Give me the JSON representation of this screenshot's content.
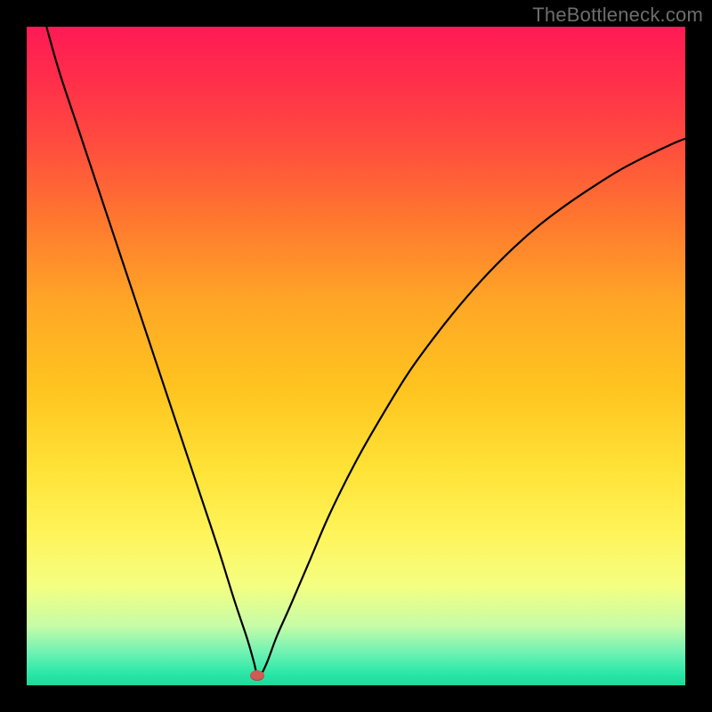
{
  "watermark": "TheBottleneck.com",
  "chart_data": {
    "type": "line",
    "title": "",
    "xlabel": "",
    "ylabel": "",
    "xlim": [
      0,
      100
    ],
    "ylim": [
      0,
      100
    ],
    "grid": false,
    "series": [
      {
        "name": "curve",
        "x": [
          3,
          5,
          8,
          11,
          14,
          17,
          20,
          23,
          26,
          29,
          31.5,
          33.5,
          34.5,
          35,
          35.5,
          36.5,
          38,
          40,
          43,
          46,
          50,
          54,
          58,
          62,
          66,
          70,
          74,
          78,
          82,
          86,
          90,
          94,
          98,
          100
        ],
        "values": [
          100,
          93,
          84,
          75,
          66,
          57,
          48,
          39,
          30,
          21,
          13,
          7,
          3.5,
          1.5,
          1.5,
          3.5,
          7.5,
          12,
          19,
          26,
          34,
          41,
          47.5,
          53,
          58,
          62.5,
          66.5,
          70,
          73,
          75.7,
          78.2,
          80.3,
          82.2,
          83
        ],
        "color": "#000000"
      }
    ],
    "marker": {
      "x": 35,
      "y": 1.5,
      "color": "#d15a55"
    }
  }
}
